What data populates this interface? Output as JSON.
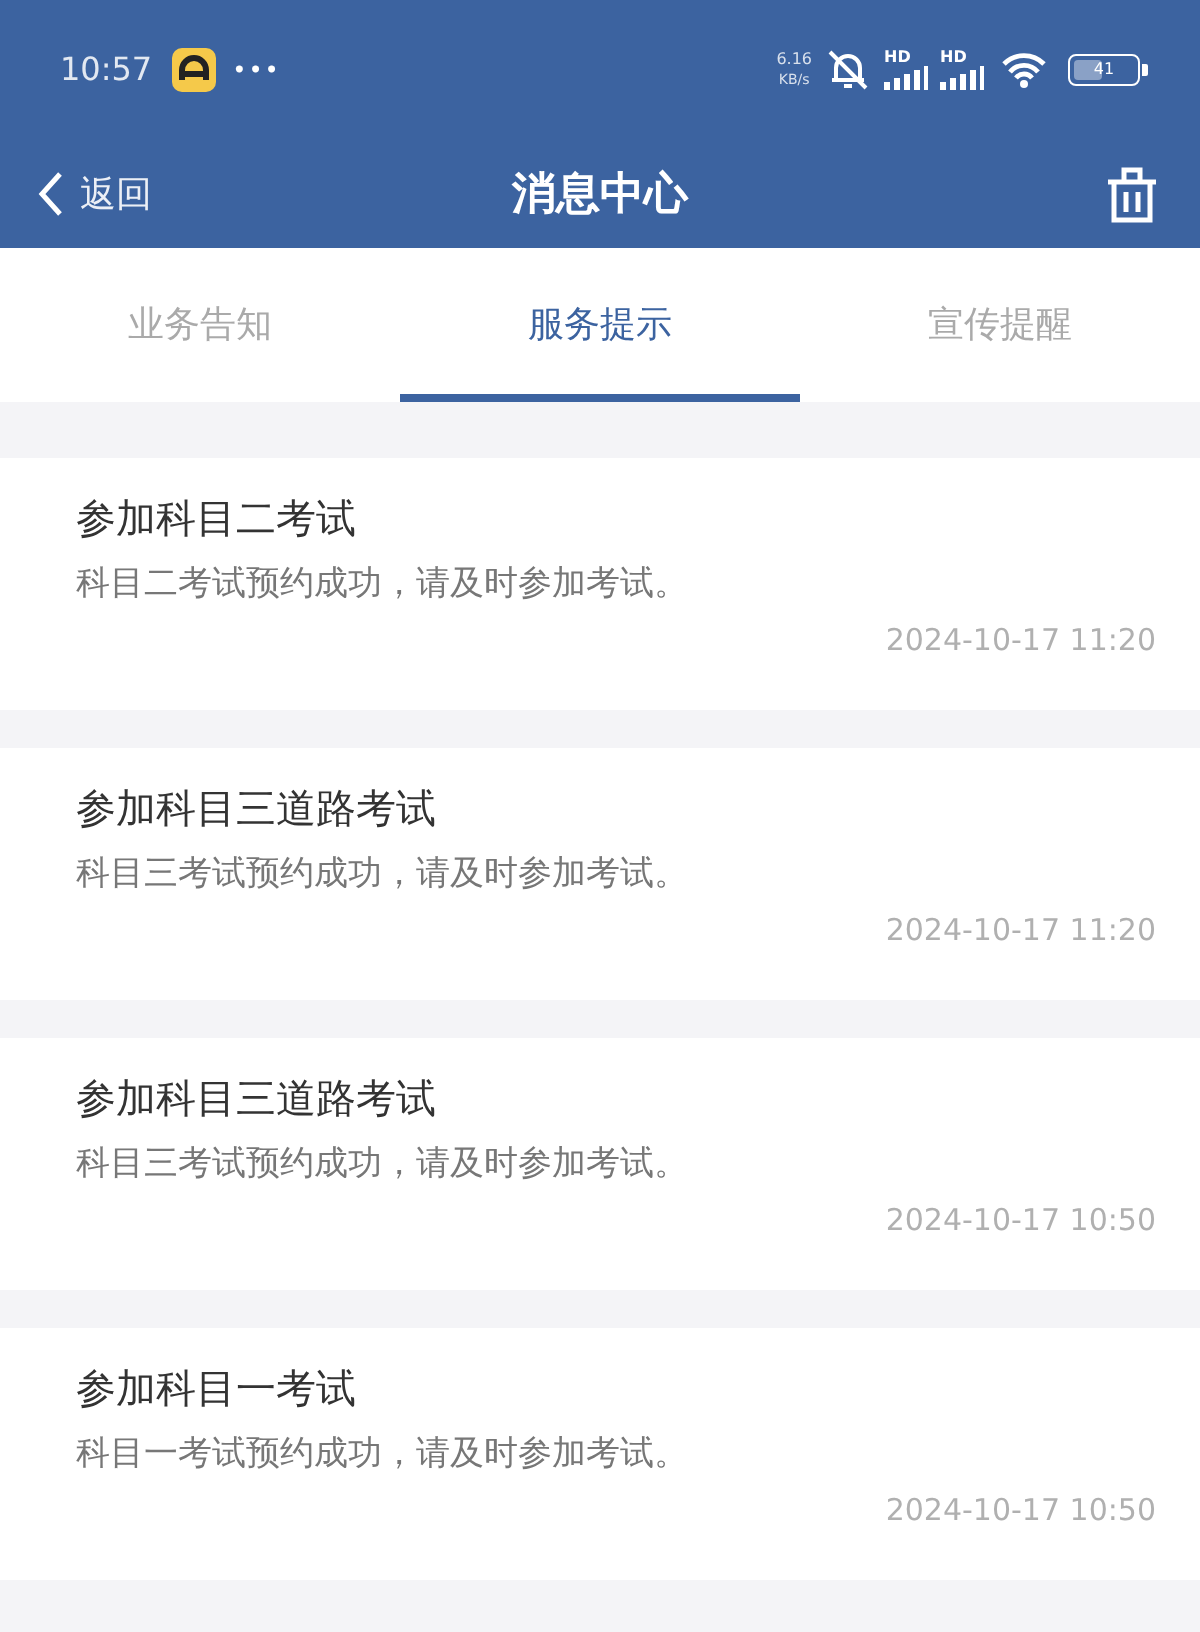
{
  "status_bar": {
    "time": "10:57",
    "more": "•••",
    "net_speed": "6.16",
    "net_unit": "KB/s",
    "sim_labels": [
      "HD",
      "HD"
    ],
    "battery": "41"
  },
  "header": {
    "back": "返回",
    "title": "消息中心"
  },
  "tabs": [
    {
      "label": "业务告知",
      "selected": false
    },
    {
      "label": "服务提示",
      "selected": true
    },
    {
      "label": "宣传提醒",
      "selected": false
    }
  ],
  "messages": [
    {
      "title": "参加科目二考试",
      "body": "科目二考试预约成功，请及时参加考试。",
      "time": "2024-10-17 11:20"
    },
    {
      "title": "参加科目三道路考试",
      "body": "科目三考试预约成功，请及时参加考试。",
      "time": "2024-10-17 11:20"
    },
    {
      "title": "参加科目三道路考试",
      "body": "科目三考试预约成功，请及时参加考试。",
      "time": "2024-10-17 10:50"
    },
    {
      "title": "参加科目一考试",
      "body": "科目一考试预约成功，请及时参加考试。",
      "time": "2024-10-17 10:50"
    }
  ]
}
